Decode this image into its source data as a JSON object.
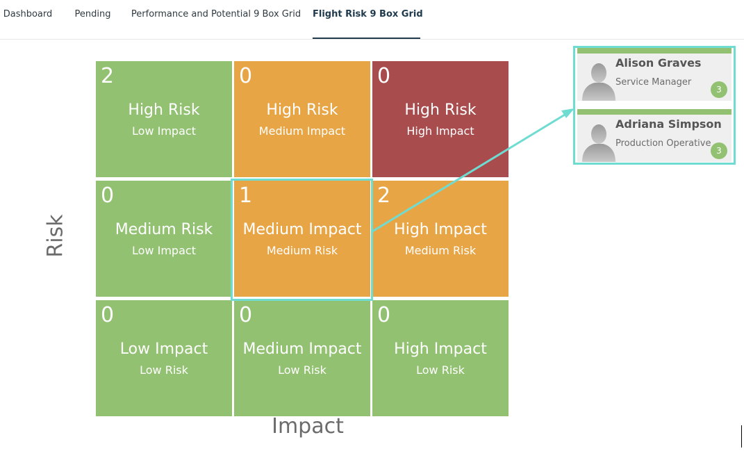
{
  "tabs": [
    {
      "label": "Dashboard",
      "active": false
    },
    {
      "label": "Pending",
      "active": false
    },
    {
      "label": "Performance and Potential 9 Box Grid",
      "active": false
    },
    {
      "label": "Flight Risk 9 Box Grid",
      "active": true
    }
  ],
  "grid": {
    "cells": [
      {
        "count": "2",
        "line1": "High Risk",
        "line2": "Low Impact",
        "color": "#92c172"
      },
      {
        "count": "0",
        "line1": "High Risk",
        "line2": "Medium Impact",
        "color": "#e8a546"
      },
      {
        "count": "0",
        "line1": "High Risk",
        "line2": "High Impact",
        "color": "#a84c4e"
      },
      {
        "count": "0",
        "line1": "Medium Risk",
        "line2": "Low Impact",
        "color": "#92c172"
      },
      {
        "count": "1",
        "line1": "Medium Impact",
        "line2": "Medium Risk",
        "color": "#e8a546"
      },
      {
        "count": "2",
        "line1": "High Impact",
        "line2": "Medium Risk",
        "color": "#e8a546"
      },
      {
        "count": "0",
        "line1": "Low Impact",
        "line2": "Low Risk",
        "color": "#92c172"
      },
      {
        "count": "0",
        "line1": "Medium Impact",
        "line2": "Low Risk",
        "color": "#92c172"
      },
      {
        "count": "0",
        "line1": "High Impact",
        "line2": "Low Risk",
        "color": "#92c172"
      }
    ],
    "y_axis_label": "Risk",
    "x_axis_label": "Impact"
  },
  "employees": [
    {
      "name": "Alison Graves",
      "role": "Service Manager",
      "badge": "3"
    },
    {
      "name": "Adriana Simpson",
      "role": "Production Operative",
      "badge": "3"
    }
  ],
  "colors": {
    "highlight": "#6fdcd2",
    "green": "#92c172",
    "orange": "#e8a546",
    "red": "#a84c4e"
  }
}
